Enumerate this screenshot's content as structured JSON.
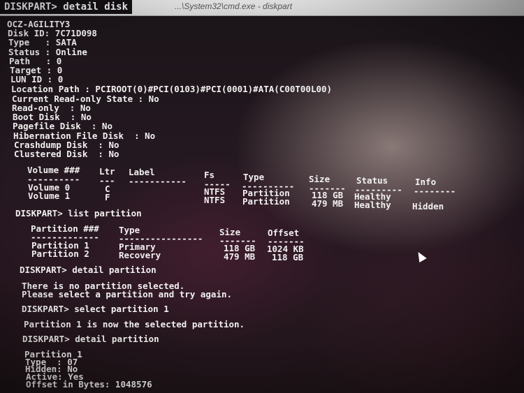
{
  "window": {
    "title": "...\\System32\\cmd.exe - diskpart",
    "command": "DISKPART> detail disk"
  },
  "disk": {
    "model": "OCZ-AGILITY3",
    "disk_id": "Disk ID: 7C71D098",
    "type": "Type   : SATA",
    "status": "Status : Online",
    "path": "Path   : 0",
    "target": "Target : 0",
    "lun": "LUN ID : 0",
    "location": "Location Path : PCIROOT(0)#PCI(0103)#PCI(0001)#ATA(C00T00L00)",
    "readonly_state": "Current Read-only State : No",
    "readonly": "Read-only  : No",
    "boot": "Boot Disk  : No",
    "pagefile": "Pagefile Disk  : No",
    "hibernation": "Hibernation File Disk  : No",
    "crashdump": "Crashdump Disk  : No",
    "clustered": "Clustered Disk  : No"
  },
  "volume_table": {
    "headers": [
      "Volume ###",
      "Ltr",
      "Label",
      "Fs",
      "Type",
      "Size",
      "Status",
      "Info"
    ],
    "separators": [
      "----------",
      "---",
      "-----------",
      "-----",
      "----------",
      "-------",
      "---------",
      "--------"
    ],
    "rows": [
      [
        "Volume 0",
        "C",
        "",
        "NTFS",
        "Partition",
        "118 GB",
        "Healthy",
        ""
      ],
      [
        "Volume 1",
        "F",
        "",
        "NTFS",
        "Partition",
        "479 MB",
        "Healthy",
        "Hidden"
      ]
    ]
  },
  "list_partition": {
    "command": "DISKPART> list partition",
    "headers": [
      "Partition ###",
      "Type",
      "Size",
      "Offset"
    ],
    "separators": [
      "-------------",
      "----------------",
      "-------",
      "-------"
    ],
    "rows": [
      [
        "Partition 1",
        "Primary",
        "118 GB",
        "1024 KB"
      ],
      [
        "Partition 2",
        "Recovery",
        "479 MB",
        "118 GB"
      ]
    ]
  },
  "detail_partition_1": {
    "command": "DISKPART> detail partition",
    "msg1": "There is no partition selected.",
    "msg2": "Please select a partition and try again."
  },
  "select_partition": {
    "command": "DISKPART> select partition 1",
    "msg": "Partition 1 is now the selected partition."
  },
  "detail_partition_2": {
    "command": "DISKPART> detail partition",
    "partition": "Partition 1",
    "type": "Type  : 07",
    "hidden": "Hidden: No",
    "active": "Active: Yes",
    "offset": "Offset in Bytes: 1048576"
  }
}
